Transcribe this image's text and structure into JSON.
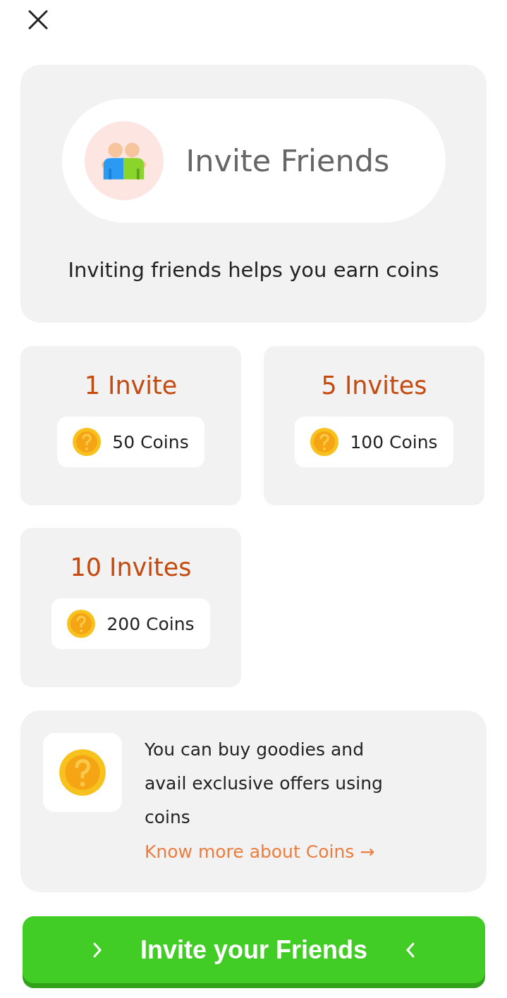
{
  "hero": {
    "title": "Invite Friends",
    "subtitle": "Inviting friends helps you earn coins"
  },
  "rewards": [
    {
      "title": "1 Invite",
      "coins": "50 Coins"
    },
    {
      "title": "5 Invites",
      "coins": "100 Coins"
    },
    {
      "title": "10 Invites",
      "coins": "200 Coins"
    }
  ],
  "info": {
    "text": "You can buy goodies and avail exclusive offers using coins",
    "link": "Know more about Coins →"
  },
  "cta": {
    "label": "Invite your Friends"
  }
}
